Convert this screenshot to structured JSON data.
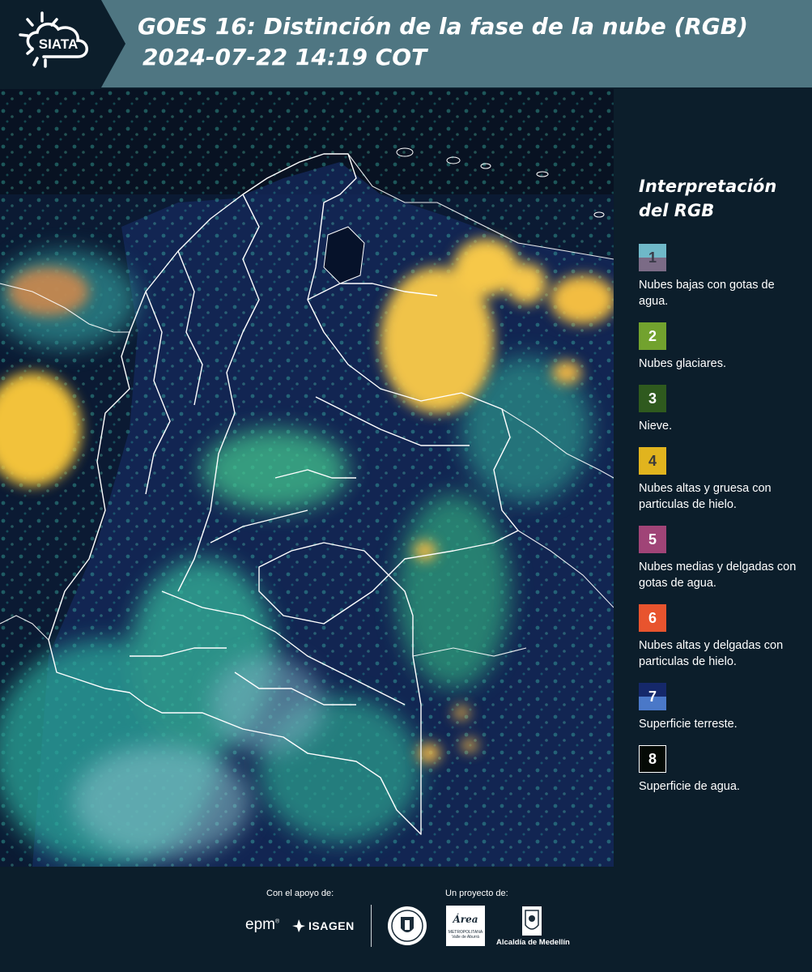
{
  "header": {
    "logo_text": "SIATA",
    "title_line1": "GOES 16: Distinción de la fase de la nube (RGB)",
    "title_line2": "2024-07-22 14:19 COT"
  },
  "legend": {
    "title_line1": "Interpretación",
    "title_line2": "del RGB",
    "items": [
      {
        "number": "1",
        "label": "Nubes bajas con gotas de agua.",
        "color_top": "#6fb8c8",
        "color_bottom": "#7b6b86",
        "text_color": "#3a3a48"
      },
      {
        "number": "2",
        "label": "Nubes glaciares.",
        "color_top": "#72a22e",
        "color_bottom": "#72a22e",
        "text_color": "#ffffff"
      },
      {
        "number": "3",
        "label": "Nieve.",
        "color_top": "#2f5a1e",
        "color_bottom": "#2f5a1e",
        "text_color": "#ffffff"
      },
      {
        "number": "4",
        "label": "Nubes altas y gruesa con particulas de hielo.",
        "color_top": "#e1b41e",
        "color_bottom": "#e1b41e",
        "text_color": "#3a3a3a"
      },
      {
        "number": "5",
        "label": "Nubes medias y delgadas con gotas de agua.",
        "color_top": "#a04477",
        "color_bottom": "#a04477",
        "text_color": "#ffffff"
      },
      {
        "number": "6",
        "label": "Nubes altas y delgadas con particulas de hielo.",
        "color_top": "#e8542e",
        "color_bottom": "#e8542e",
        "text_color": "#ffffff"
      },
      {
        "number": "7",
        "label": "Superficie terreste.",
        "color_top": "#15286a",
        "color_bottom": "#4a78c8",
        "text_color": "#ffffff"
      },
      {
        "number": "8",
        "label": "Superficie de agua.",
        "color_top": "#050a06",
        "color_bottom": "#050a06",
        "text_color": "#ffffff"
      }
    ]
  },
  "footer": {
    "support_label": "Con el apoyo de:",
    "project_label": "Un proyecto de:",
    "epm": "epm",
    "isagen": "ISAGEN",
    "area_label": "Área",
    "area_sub1": "METROPOLITANA",
    "area_sub2": "Valle de Aburrá",
    "alcaldia": "Alcaldía de Medellín"
  },
  "colors": {
    "header_bg": "#4f7682",
    "logo_bg": "#0c1e2b",
    "page_bg": "#0c1e2b"
  }
}
